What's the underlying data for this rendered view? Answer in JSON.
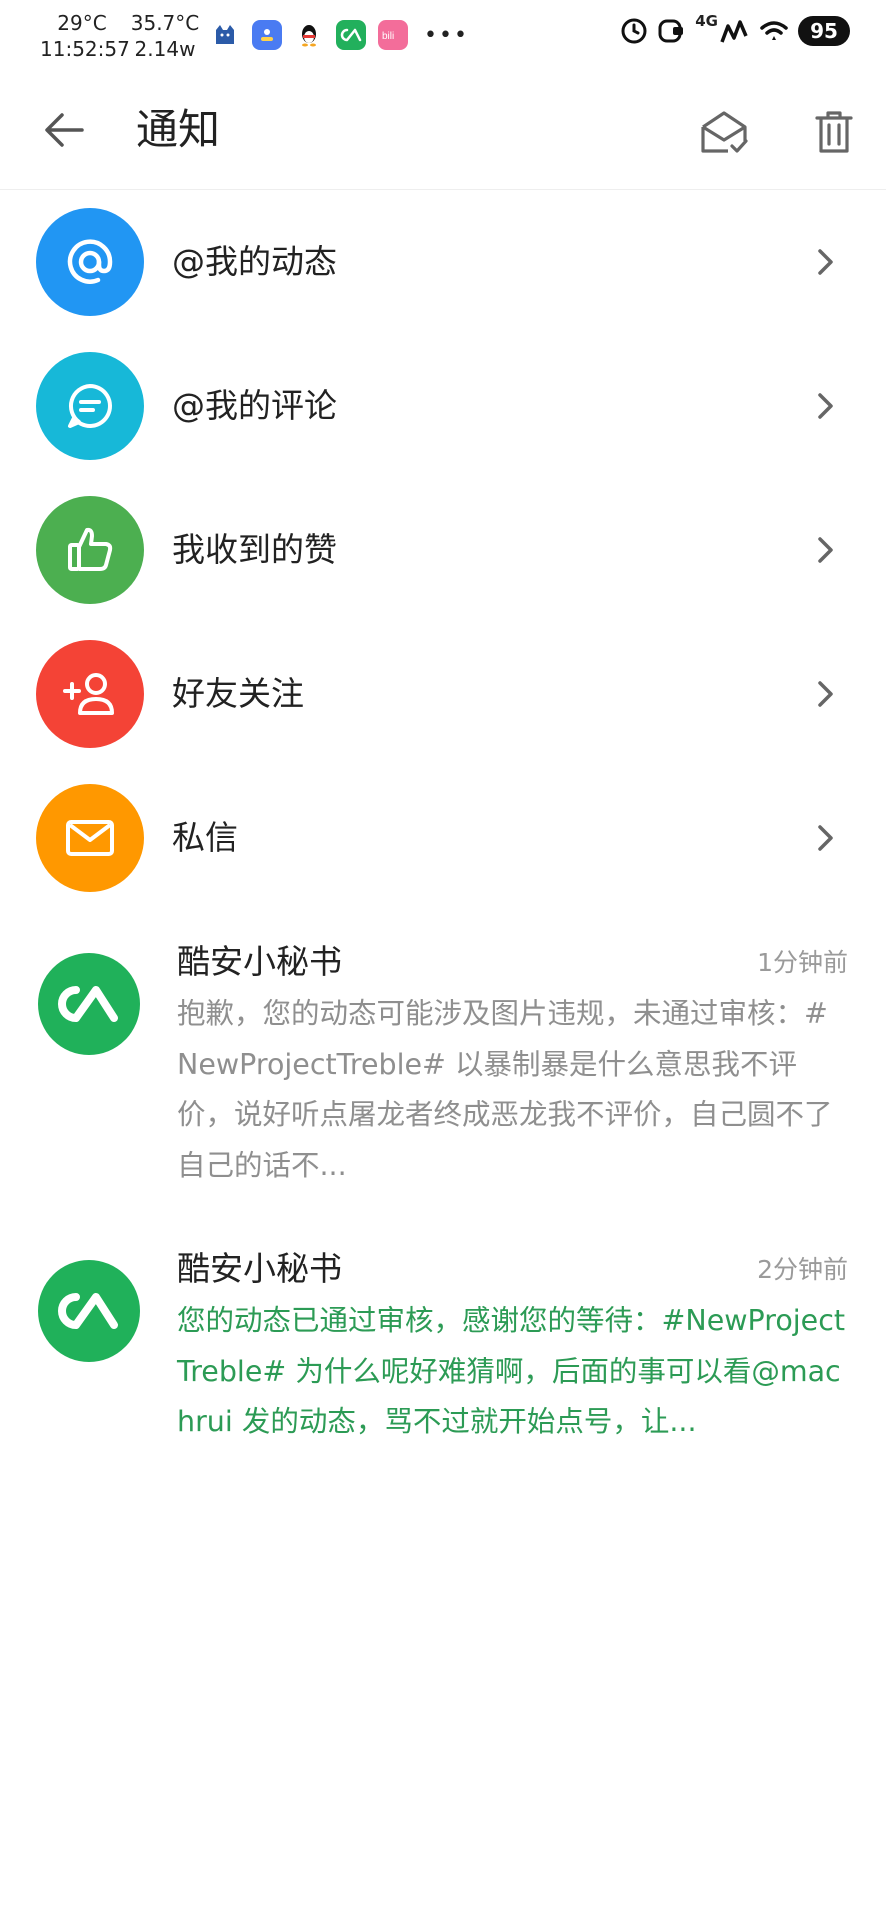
{
  "status_bar": {
    "temp1": "29°C",
    "time": "11:52:57",
    "temp2": "35.7°C",
    "power": "2.14w",
    "network": "4G",
    "battery": "95",
    "more": "•••",
    "app_icons": [
      "cat-app-icon",
      "blue-app-icon",
      "qq-penguin-icon",
      "coolapk-icon",
      "bilibili-icon"
    ]
  },
  "header": {
    "title": "通知"
  },
  "menu": [
    {
      "label": "@我的动态",
      "icon": "at-icon",
      "color": "#2196f3"
    },
    {
      "label": "@我的评论",
      "icon": "comment-bubble-icon",
      "color": "#17b8d8"
    },
    {
      "label": "我收到的赞",
      "icon": "thumbs-up-icon",
      "color": "#4caf50"
    },
    {
      "label": "好友关注",
      "icon": "add-friend-icon",
      "color": "#f44336"
    },
    {
      "label": "私信",
      "icon": "mail-icon",
      "color": "#ff9800"
    }
  ],
  "messages": [
    {
      "sender": "酷安小秘书",
      "time": "1分钟前",
      "body": "抱歉，您的动态可能涉及图片违规，未通过审核：#NewProjectTreble# 以暴制暴是什么意思我不评价，说好听点屠龙者终成恶龙我不评价，自己圆不了自己的话不...",
      "color": "#8f8f8f"
    },
    {
      "sender": "酷安小秘书",
      "time": "2分钟前",
      "body": "您的动态已通过审核，感谢您的等待：#NewProjectTreble# 为什么呢好难猜啊，后面的事可以看@machrui 发的动态，骂不过就开始点号，让...",
      "color": "#2c9b55"
    }
  ]
}
